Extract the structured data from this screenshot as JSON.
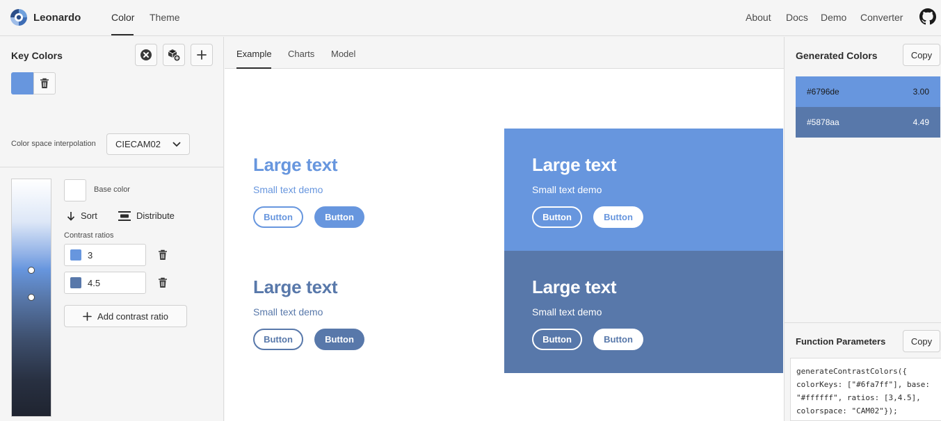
{
  "app": {
    "name": "Leonardo",
    "tabs": [
      {
        "label": "Color",
        "active": true
      },
      {
        "label": "Theme",
        "active": false
      }
    ],
    "links": [
      "About",
      "Docs",
      "Demo",
      "Converter"
    ],
    "github_icon": "github-icon"
  },
  "key_colors": {
    "title": "Key Colors",
    "icons": [
      "clear-icon",
      "cube-add-icon",
      "plus-icon"
    ],
    "swatches": [
      {
        "color": "#6796de"
      }
    ],
    "interpolation_label": "Color space interpolation",
    "interpolation_value": "CIECAM02"
  },
  "scale": {
    "base_label": "Base color",
    "base_color": "#ffffff",
    "sort_label": "Sort",
    "distribute_label": "Distribute",
    "ratios_label": "Contrast ratios",
    "ratios": [
      {
        "value": "3",
        "color": "#6796de"
      },
      {
        "value": "4.5",
        "color": "#5878aa"
      }
    ],
    "add_ratio_label": "Add contrast ratio"
  },
  "preview": {
    "tabs": [
      {
        "label": "Example",
        "active": true
      },
      {
        "label": "Charts",
        "active": false
      },
      {
        "label": "Model",
        "active": false
      }
    ],
    "demos": [
      {
        "bg": "#ffffff",
        "fg": "#6796de",
        "large": "Large text",
        "small": "Small text demo",
        "button1": "Button",
        "button2": "Button"
      },
      {
        "bg": "#6796de",
        "fg": "#ffffff",
        "large": "Large text",
        "small": "Small text demo",
        "button1": "Button",
        "button2": "Button"
      },
      {
        "bg": "#ffffff",
        "fg": "#5878aa",
        "large": "Large text",
        "small": "Small text demo",
        "button1": "Button",
        "button2": "Button"
      },
      {
        "bg": "#5878aa",
        "fg": "#ffffff",
        "large": "Large text",
        "small": "Small text demo",
        "button1": "Button",
        "button2": "Button"
      }
    ]
  },
  "generated": {
    "title": "Generated Colors",
    "copy_label": "Copy",
    "colors": [
      {
        "hex": "#6796de",
        "ratio": "3.00"
      },
      {
        "hex": "#5878aa",
        "ratio": "4.49"
      }
    ]
  },
  "function_params": {
    "title": "Function Parameters",
    "copy_label": "Copy",
    "code": "generateContrastColors({\ncolorKeys: [\"#6fa7ff\"], base:\n\"#ffffff\", ratios: [3,4.5],\ncolorspace: \"CAM02\"});"
  }
}
